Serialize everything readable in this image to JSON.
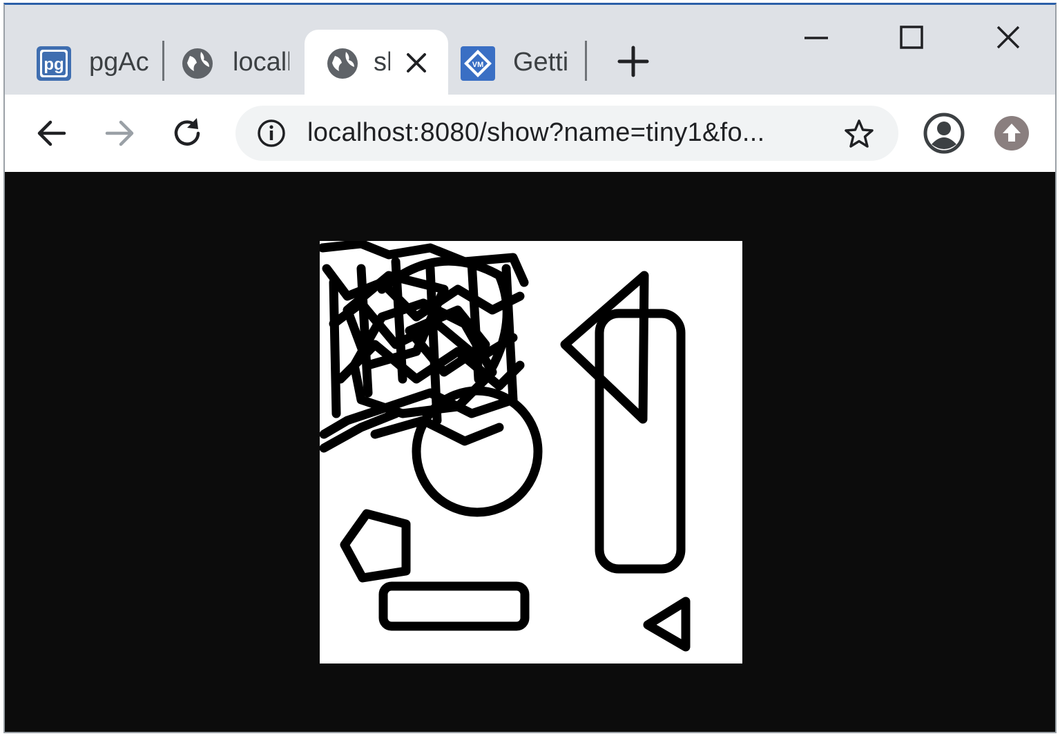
{
  "browser": {
    "tabs": [
      {
        "title": "pgAc",
        "favicon": "pgadmin-icon"
      },
      {
        "title": "locall",
        "favicon": "globe-icon"
      },
      {
        "title": "sl",
        "favicon": "globe-icon",
        "active": true
      },
      {
        "title": "Getti",
        "favicon": "bookmark-site-icon"
      }
    ],
    "new_tab_icon": "plus-icon",
    "window_controls": [
      "minimize-icon",
      "maximize-icon",
      "close-icon"
    ]
  },
  "toolbar": {
    "back_icon": "arrow-left-icon",
    "forward_icon": "arrow-right-icon",
    "reload_icon": "reload-icon",
    "site_info_icon": "info-icon",
    "url": "localhost:8080/show?name=tiny1&fo...",
    "bookmark_icon": "star-icon",
    "profile_icon": "account-icon",
    "update_icon": "update-icon"
  },
  "page": {
    "image": "hand-drawn shapes image",
    "background": "#0c0c0c"
  }
}
